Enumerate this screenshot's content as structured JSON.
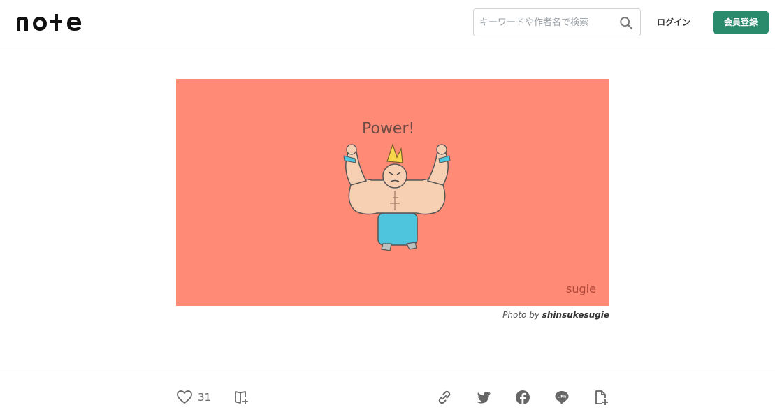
{
  "header": {
    "logo_text": "note",
    "search_placeholder": "キーワードや作者名で検索",
    "login_label": "ログイン",
    "signup_label": "会員登録"
  },
  "hero": {
    "illustration_text": "Power!",
    "signature_text": "sugie",
    "credit_prefix": "Photo by ",
    "credit_author": "shinsukesugie"
  },
  "actions": {
    "like_count": "31",
    "icons": [
      "heart-icon",
      "add-to-magazine-icon",
      "link-icon",
      "twitter-icon",
      "facebook-icon",
      "line-icon",
      "add-note-icon"
    ]
  },
  "colors": {
    "brand_green": "#2a8a6c",
    "hero_background": "#ff8b77",
    "icon_gray": "#666666"
  }
}
